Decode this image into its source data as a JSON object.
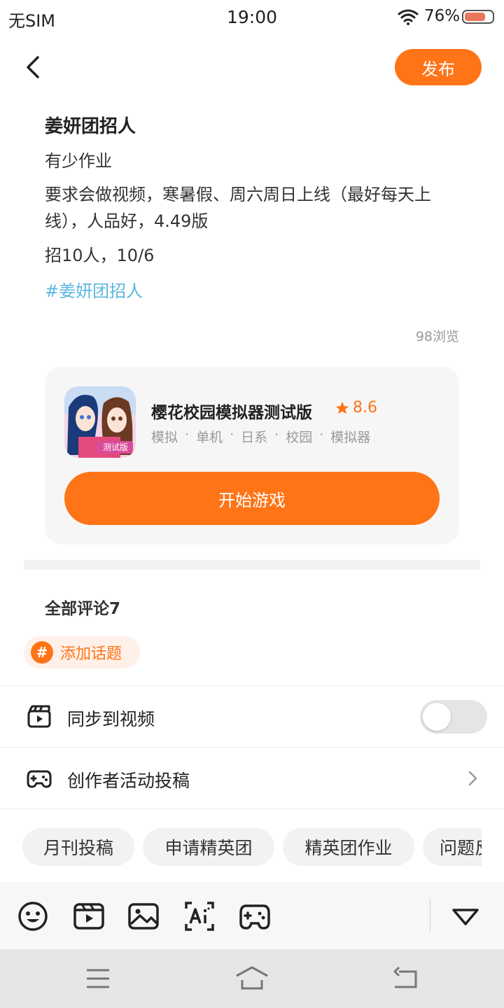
{
  "status_bar": {
    "carrier": "无SIM",
    "time": "19:00",
    "battery_percent": "76%",
    "battery_level": 0.76
  },
  "header": {
    "publish_label": "发布"
  },
  "post": {
    "title": "姜妍团招人",
    "lines": [
      "有少作业",
      "要求会做视频，寒暑假、周六周日上线（最好每天上线），人品好，4.49版",
      "招10人，10/6"
    ],
    "hashtag": "#姜妍团招人",
    "views": "98浏览"
  },
  "game_card": {
    "name": "樱花校园模拟器测试版",
    "rating": "8.6",
    "tags": [
      "模拟",
      "·",
      "单机",
      "·",
      "日系",
      "·",
      "校园",
      "·",
      "模拟器"
    ],
    "icon_badge": "测试版",
    "start_label": "开始游戏"
  },
  "comments": {
    "title": "全部评论7"
  },
  "topic_chip": {
    "label": "添加话题"
  },
  "settings": {
    "sync_video_label": "同步到视频",
    "sync_video_on": false,
    "creator_label": "创作者活动投稿"
  },
  "chips": [
    "月刊投稿",
    "申请精英团",
    "精英团作业",
    "问题反馈"
  ],
  "colors": {
    "accent": "#ff7417",
    "hashtag": "#5bb7e0",
    "muted": "#9a9a9a"
  },
  "icons": {
    "toolbar": [
      "emoji-icon",
      "video-icon",
      "image-icon",
      "ai-text-icon",
      "game-controller-icon",
      "collapse-triangle-icon"
    ],
    "nav": [
      "menu-icon",
      "home-icon",
      "back-icon"
    ]
  }
}
